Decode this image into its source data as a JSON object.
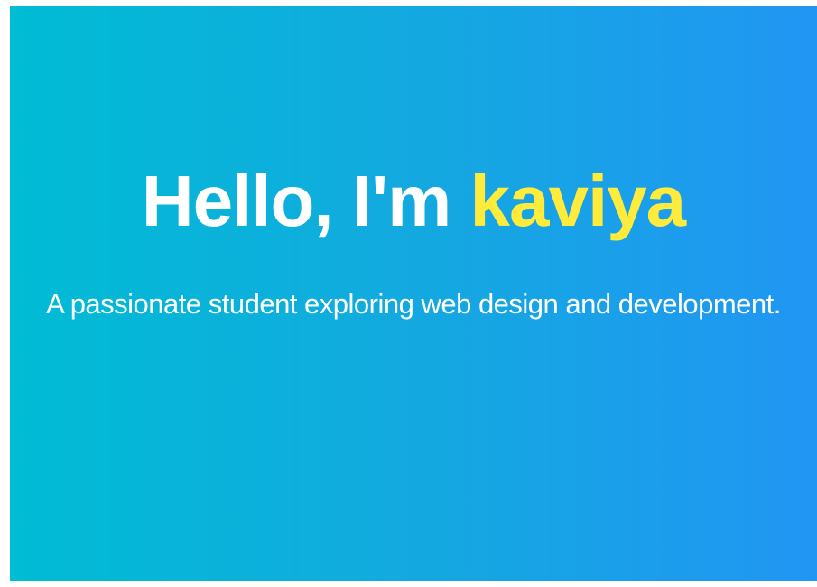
{
  "hero": {
    "greeting": "Hello, I'm ",
    "name": "kaviya",
    "subtitle": "A passionate student exploring web design and development."
  },
  "colors": {
    "gradient_start": "#00bcd4",
    "gradient_end": "#2196f3",
    "title_text": "#ffffff",
    "name_highlight": "#ffeb3b",
    "subtitle_text": "#ffffff"
  }
}
